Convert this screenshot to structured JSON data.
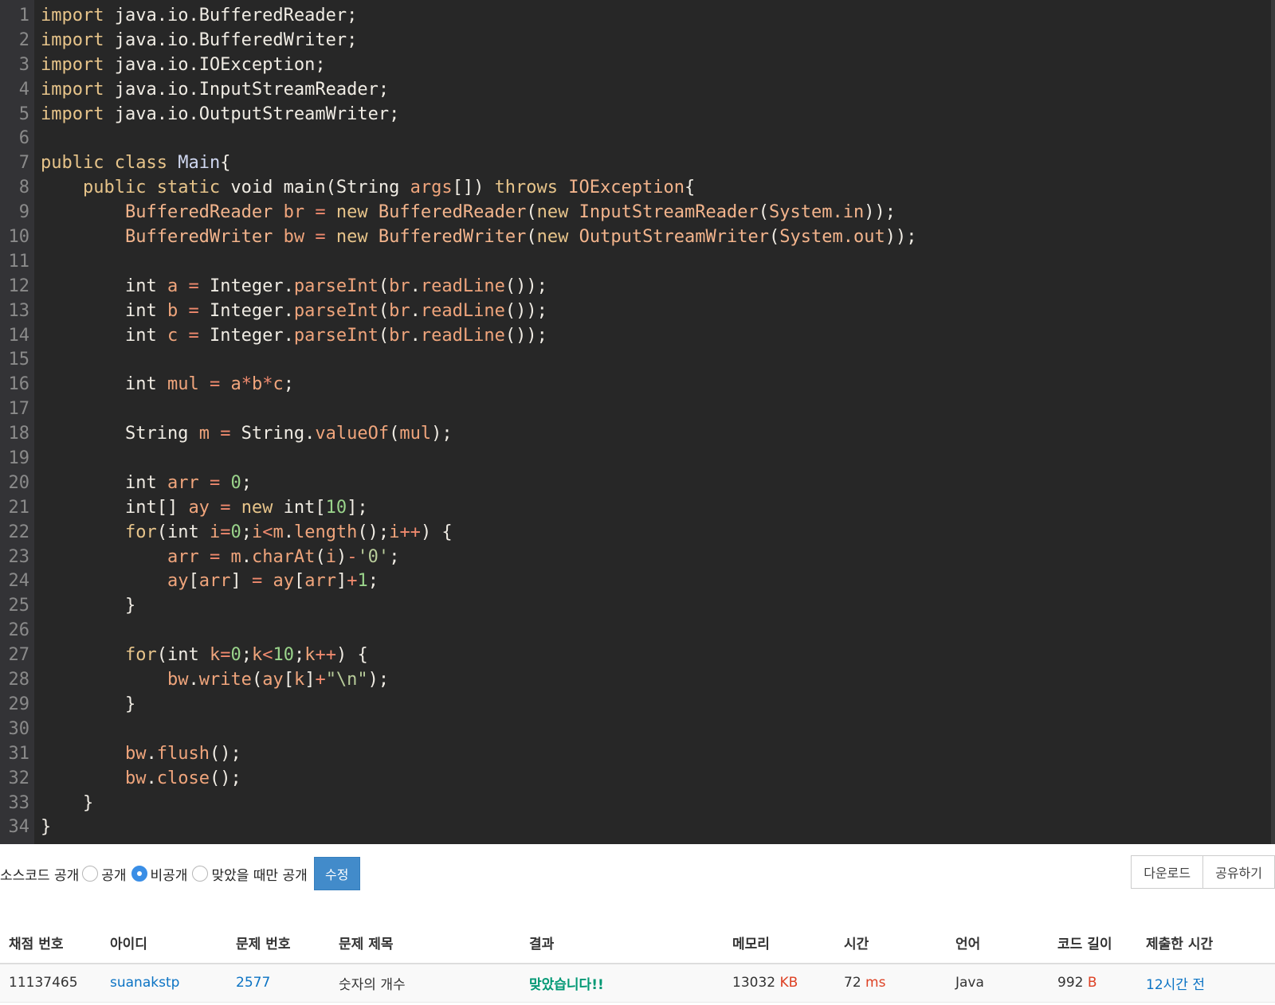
{
  "code": {
    "line_numbers": [
      "1",
      "2",
      "3",
      "4",
      "5",
      "6",
      "7",
      "8",
      "9",
      "10",
      "11",
      "12",
      "13",
      "14",
      "15",
      "16",
      "17",
      "18",
      "19",
      "20",
      "21",
      "22",
      "23",
      "24",
      "25",
      "26",
      "27",
      "28",
      "29",
      "30",
      "31",
      "32",
      "33",
      "34"
    ],
    "lines": [
      [
        [
          "kw",
          "import"
        ],
        [
          "def",
          " java.io.BufferedReader;"
        ]
      ],
      [
        [
          "kw",
          "import"
        ],
        [
          "def",
          " java.io.BufferedWriter;"
        ]
      ],
      [
        [
          "kw",
          "import"
        ],
        [
          "def",
          " java.io.IOException;"
        ]
      ],
      [
        [
          "kw",
          "import"
        ],
        [
          "def",
          " java.io.InputStreamReader;"
        ]
      ],
      [
        [
          "kw",
          "import"
        ],
        [
          "def",
          " java.io.OutputStreamWriter;"
        ]
      ],
      [],
      [
        [
          "kw",
          "public class"
        ],
        [
          "def",
          " "
        ],
        [
          "cls",
          "Main"
        ],
        [
          "pun",
          "{"
        ]
      ],
      [
        [
          "def",
          "    "
        ],
        [
          "kw",
          "public static"
        ],
        [
          "def",
          " void main(String "
        ],
        [
          "var",
          "args"
        ],
        [
          "def",
          "[]) "
        ],
        [
          "kw",
          "throws"
        ],
        [
          "def",
          " "
        ],
        [
          "typ",
          "IOException"
        ],
        [
          "pun",
          "{"
        ]
      ],
      [
        [
          "def",
          "        "
        ],
        [
          "typ",
          "BufferedReader"
        ],
        [
          "def",
          " "
        ],
        [
          "var",
          "br"
        ],
        [
          "def",
          " "
        ],
        [
          "op",
          "="
        ],
        [
          "def",
          " "
        ],
        [
          "kw",
          "new"
        ],
        [
          "def",
          " "
        ],
        [
          "typ",
          "BufferedReader"
        ],
        [
          "pun",
          "("
        ],
        [
          "kw",
          "new"
        ],
        [
          "def",
          " "
        ],
        [
          "typ",
          "InputStreamReader"
        ],
        [
          "pun",
          "("
        ],
        [
          "typ",
          "System.in"
        ],
        [
          "pun",
          "));"
        ]
      ],
      [
        [
          "def",
          "        "
        ],
        [
          "typ",
          "BufferedWriter"
        ],
        [
          "def",
          " "
        ],
        [
          "var",
          "bw"
        ],
        [
          "def",
          " "
        ],
        [
          "op",
          "="
        ],
        [
          "def",
          " "
        ],
        [
          "kw",
          "new"
        ],
        [
          "def",
          " "
        ],
        [
          "typ",
          "BufferedWriter"
        ],
        [
          "pun",
          "("
        ],
        [
          "kw",
          "new"
        ],
        [
          "def",
          " "
        ],
        [
          "typ",
          "OutputStreamWriter"
        ],
        [
          "pun",
          "("
        ],
        [
          "typ",
          "System.out"
        ],
        [
          "pun",
          "));"
        ]
      ],
      [],
      [
        [
          "def",
          "        int "
        ],
        [
          "var",
          "a"
        ],
        [
          "def",
          " "
        ],
        [
          "op",
          "="
        ],
        [
          "def",
          " Integer."
        ],
        [
          "fn",
          "parseInt"
        ],
        [
          "pun",
          "("
        ],
        [
          "var",
          "br"
        ],
        [
          "def",
          "."
        ],
        [
          "fn",
          "readLine"
        ],
        [
          "pun",
          "());"
        ]
      ],
      [
        [
          "def",
          "        int "
        ],
        [
          "var",
          "b"
        ],
        [
          "def",
          " "
        ],
        [
          "op",
          "="
        ],
        [
          "def",
          " Integer."
        ],
        [
          "fn",
          "parseInt"
        ],
        [
          "pun",
          "("
        ],
        [
          "var",
          "br"
        ],
        [
          "def",
          "."
        ],
        [
          "fn",
          "readLine"
        ],
        [
          "pun",
          "());"
        ]
      ],
      [
        [
          "def",
          "        int "
        ],
        [
          "var",
          "c"
        ],
        [
          "def",
          " "
        ],
        [
          "op",
          "="
        ],
        [
          "def",
          " Integer."
        ],
        [
          "fn",
          "parseInt"
        ],
        [
          "pun",
          "("
        ],
        [
          "var",
          "br"
        ],
        [
          "def",
          "."
        ],
        [
          "fn",
          "readLine"
        ],
        [
          "pun",
          "());"
        ]
      ],
      [],
      [
        [
          "def",
          "        int "
        ],
        [
          "var",
          "mul"
        ],
        [
          "def",
          " "
        ],
        [
          "op",
          "="
        ],
        [
          "def",
          " "
        ],
        [
          "var",
          "a"
        ],
        [
          "op",
          "*"
        ],
        [
          "var",
          "b"
        ],
        [
          "op",
          "*"
        ],
        [
          "var",
          "c"
        ],
        [
          "pun",
          ";"
        ]
      ],
      [],
      [
        [
          "def",
          "        String "
        ],
        [
          "var",
          "m"
        ],
        [
          "def",
          " "
        ],
        [
          "op",
          "="
        ],
        [
          "def",
          " String."
        ],
        [
          "fn",
          "valueOf"
        ],
        [
          "pun",
          "("
        ],
        [
          "var",
          "mul"
        ],
        [
          "pun",
          ");"
        ]
      ],
      [],
      [
        [
          "def",
          "        int "
        ],
        [
          "var",
          "arr"
        ],
        [
          "def",
          " "
        ],
        [
          "op",
          "="
        ],
        [
          "def",
          " "
        ],
        [
          "num",
          "0"
        ],
        [
          "pun",
          ";"
        ]
      ],
      [
        [
          "def",
          "        int[] "
        ],
        [
          "var",
          "ay"
        ],
        [
          "def",
          " "
        ],
        [
          "op",
          "="
        ],
        [
          "def",
          " "
        ],
        [
          "kw",
          "new"
        ],
        [
          "def",
          " int["
        ],
        [
          "num",
          "10"
        ],
        [
          "pun",
          "];"
        ]
      ],
      [
        [
          "def",
          "        "
        ],
        [
          "kw",
          "for"
        ],
        [
          "pun",
          "("
        ],
        [
          "def",
          "int "
        ],
        [
          "var",
          "i"
        ],
        [
          "op",
          "="
        ],
        [
          "num",
          "0"
        ],
        [
          "pun",
          ";"
        ],
        [
          "var",
          "i"
        ],
        [
          "op",
          "<"
        ],
        [
          "var",
          "m"
        ],
        [
          "def",
          "."
        ],
        [
          "fn",
          "length"
        ],
        [
          "pun",
          "();"
        ],
        [
          "var",
          "i"
        ],
        [
          "op",
          "++"
        ],
        [
          "pun",
          ") {"
        ]
      ],
      [
        [
          "def",
          "            "
        ],
        [
          "var",
          "arr"
        ],
        [
          "def",
          " "
        ],
        [
          "op",
          "="
        ],
        [
          "def",
          " "
        ],
        [
          "var",
          "m"
        ],
        [
          "def",
          "."
        ],
        [
          "fn",
          "charAt"
        ],
        [
          "pun",
          "("
        ],
        [
          "var",
          "i"
        ],
        [
          "pun",
          ")"
        ],
        [
          "op",
          "-"
        ],
        [
          "str",
          "'0'"
        ],
        [
          "pun",
          ";"
        ]
      ],
      [
        [
          "def",
          "            "
        ],
        [
          "var",
          "ay"
        ],
        [
          "pun",
          "["
        ],
        [
          "var",
          "arr"
        ],
        [
          "pun",
          "]"
        ],
        [
          "def",
          " "
        ],
        [
          "op",
          "="
        ],
        [
          "def",
          " "
        ],
        [
          "var",
          "ay"
        ],
        [
          "pun",
          "["
        ],
        [
          "var",
          "arr"
        ],
        [
          "pun",
          "]"
        ],
        [
          "op",
          "+"
        ],
        [
          "num",
          "1"
        ],
        [
          "pun",
          ";"
        ]
      ],
      [
        [
          "def",
          "        }"
        ]
      ],
      [],
      [
        [
          "def",
          "        "
        ],
        [
          "kw",
          "for"
        ],
        [
          "pun",
          "("
        ],
        [
          "def",
          "int "
        ],
        [
          "var",
          "k"
        ],
        [
          "op",
          "="
        ],
        [
          "num",
          "0"
        ],
        [
          "pun",
          ";"
        ],
        [
          "var",
          "k"
        ],
        [
          "op",
          "<"
        ],
        [
          "num",
          "10"
        ],
        [
          "pun",
          ";"
        ],
        [
          "var",
          "k"
        ],
        [
          "op",
          "++"
        ],
        [
          "pun",
          ") {"
        ]
      ],
      [
        [
          "def",
          "            "
        ],
        [
          "var",
          "bw"
        ],
        [
          "def",
          "."
        ],
        [
          "fn",
          "write"
        ],
        [
          "pun",
          "("
        ],
        [
          "var",
          "ay"
        ],
        [
          "pun",
          "["
        ],
        [
          "var",
          "k"
        ],
        [
          "pun",
          "]"
        ],
        [
          "op",
          "+"
        ],
        [
          "str",
          "\"\\n\""
        ],
        [
          "pun",
          ");"
        ]
      ],
      [
        [
          "def",
          "        }"
        ]
      ],
      [],
      [
        [
          "def",
          "        "
        ],
        [
          "var",
          "bw"
        ],
        [
          "def",
          "."
        ],
        [
          "fn",
          "flush"
        ],
        [
          "pun",
          "();"
        ]
      ],
      [
        [
          "def",
          "        "
        ],
        [
          "var",
          "bw"
        ],
        [
          "def",
          "."
        ],
        [
          "fn",
          "close"
        ],
        [
          "pun",
          "();"
        ]
      ],
      [
        [
          "def",
          "    }"
        ]
      ],
      [
        [
          "def",
          "}"
        ]
      ]
    ]
  },
  "controls": {
    "visibility_label": "소스코드 공개",
    "options": [
      {
        "label": "공개",
        "checked": false
      },
      {
        "label": "비공개",
        "checked": true
      },
      {
        "label": "맞았을 때만 공개",
        "checked": false
      }
    ],
    "edit_label": "수정",
    "download_label": "다운로드",
    "share_label": "공유하기"
  },
  "table": {
    "headers": [
      "채점 번호",
      "아이디",
      "문제 번호",
      "문제 제목",
      "결과",
      "메모리",
      "시간",
      "언어",
      "코드 길이",
      "제출한 시간"
    ],
    "row": {
      "submission_id": "11137465",
      "user_id": "suanakstp",
      "problem_id": "2577",
      "problem_title": "숫자의 개수",
      "result": "맞았습니다!!",
      "memory_value": "13032",
      "memory_unit": "KB",
      "time_value": "72",
      "time_unit": "ms",
      "language": "Java",
      "code_length_value": "992",
      "code_length_unit": "B",
      "submitted": "12시간 전"
    }
  }
}
